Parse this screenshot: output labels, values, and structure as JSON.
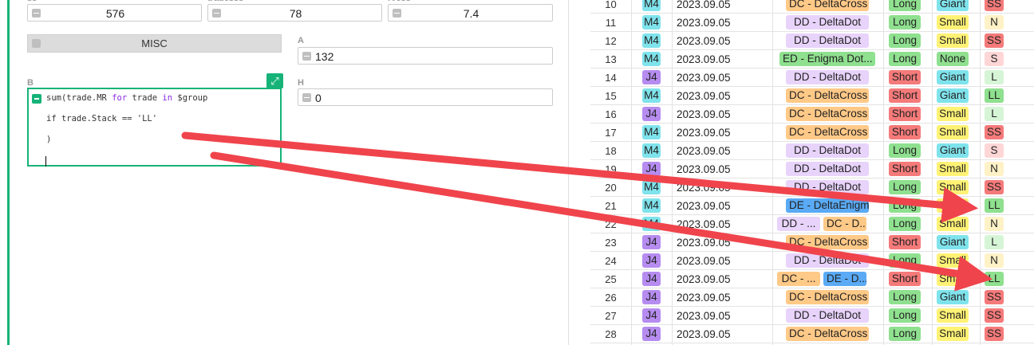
{
  "fields": {
    "top": [
      {
        "label": "ss",
        "value": "576"
      },
      {
        "label": "tradesss",
        "value": "78"
      },
      {
        "label": "rvess",
        "value": "7.4"
      }
    ],
    "misc_label": "MISC",
    "a": {
      "label": "A",
      "value": "132"
    },
    "b": {
      "label": "B"
    },
    "h": {
      "label": "H",
      "value": "0"
    }
  },
  "formula": {
    "line1": {
      "pre": "sum(trade.MR ",
      "kw1": "for",
      "mid": " trade ",
      "kw2": "in",
      "post": " $group"
    },
    "line2": "if trade.Stack == 'LL'",
    "line3": ")"
  },
  "colors": {
    "accent": "#16b378",
    "chip": {
      "M4": "#7fe3ec",
      "J4": "#b68cf0",
      "DC": "#ffc987",
      "DD": "#e8d3fb",
      "ED": "#8fe08f",
      "DE": "#5aaaf5",
      "Long": "#8fe08f",
      "Short": "#f57a7a",
      "Giant": "#7fe3ec",
      "Small": "#fff275",
      "None": "#8fe08f",
      "SS": "#f57a7a",
      "S": "#ffd6d6",
      "L": "#d6f5d6",
      "LL": "#8fe08f",
      "N": "#fff2c7"
    }
  },
  "grid": {
    "rows": [
      {
        "num": "10",
        "acct": "M4",
        "date": "2023.09.05",
        "strategies": [
          "DC - DeltaCross"
        ],
        "dir": "Long",
        "size": "Giant",
        "stack": "SS"
      },
      {
        "num": "11",
        "acct": "M4",
        "date": "2023.09.05",
        "strategies": [
          "DD - DeltaDot"
        ],
        "dir": "Long",
        "size": "Small",
        "stack": "N"
      },
      {
        "num": "12",
        "acct": "M4",
        "date": "2023.09.05",
        "strategies": [
          "DD - DeltaDot"
        ],
        "dir": "Long",
        "size": "Small",
        "stack": "SS"
      },
      {
        "num": "13",
        "acct": "M4",
        "date": "2023.09.05",
        "strategies": [
          "ED - Enigma Dot..."
        ],
        "dir": "Long",
        "size": "None",
        "stack": "S"
      },
      {
        "num": "14",
        "acct": "J4",
        "date": "2023.09.05",
        "strategies": [
          "DD - DeltaDot"
        ],
        "dir": "Short",
        "size": "Giant",
        "stack": "L"
      },
      {
        "num": "15",
        "acct": "M4",
        "date": "2023.09.05",
        "strategies": [
          "DC - DeltaCross"
        ],
        "dir": "Short",
        "size": "Giant",
        "stack": "LL"
      },
      {
        "num": "16",
        "acct": "J4",
        "date": "2023.09.05",
        "strategies": [
          "DC - DeltaCross"
        ],
        "dir": "Short",
        "size": "Small",
        "stack": "L"
      },
      {
        "num": "17",
        "acct": "M4",
        "date": "2023.09.05",
        "strategies": [
          "DC - DeltaCross"
        ],
        "dir": "Short",
        "size": "Small",
        "stack": "SS"
      },
      {
        "num": "18",
        "acct": "M4",
        "date": "2023.09.05",
        "strategies": [
          "DD - DeltaDot"
        ],
        "dir": "Long",
        "size": "Giant",
        "stack": "S"
      },
      {
        "num": "19",
        "acct": "J4",
        "date": "2023.09.05",
        "strategies": [
          "DD - DeltaDot"
        ],
        "dir": "Short",
        "size": "Small",
        "stack": "N"
      },
      {
        "num": "20",
        "acct": "M4",
        "date": "2023.09.05",
        "strategies": [
          "DD - DeltaDot"
        ],
        "dir": "Long",
        "size": "Small",
        "stack": "SS"
      },
      {
        "num": "21",
        "acct": "M4",
        "date": "2023.09.05",
        "strategies": [
          "DE - DeltaEnigma"
        ],
        "dir": "Long",
        "size": "Small",
        "stack": "LL"
      },
      {
        "num": "22",
        "acct": "M4",
        "date": "2023.09.05",
        "strategies": [
          "DD - ...",
          "DC - D..."
        ],
        "dir": "Long",
        "size": "Small",
        "stack": "N"
      },
      {
        "num": "23",
        "acct": "J4",
        "date": "2023.09.05",
        "strategies": [
          "DC - DeltaCross"
        ],
        "dir": "Short",
        "size": "Giant",
        "stack": "L"
      },
      {
        "num": "24",
        "acct": "J4",
        "date": "2023.09.05",
        "strategies": [
          "DD - DeltaDot"
        ],
        "dir": "Long",
        "size": "Small",
        "stack": "N"
      },
      {
        "num": "25",
        "acct": "J4",
        "date": "2023.09.05",
        "strategies": [
          "DC - ...",
          "DE - D..."
        ],
        "dir": "Short",
        "size": "Small",
        "stack": "LL"
      },
      {
        "num": "26",
        "acct": "J4",
        "date": "2023.09.05",
        "strategies": [
          "DC - DeltaCross"
        ],
        "dir": "Long",
        "size": "Giant",
        "stack": "SS"
      },
      {
        "num": "27",
        "acct": "J4",
        "date": "2023.09.05",
        "strategies": [
          "DD - DeltaDot"
        ],
        "dir": "Long",
        "size": "Small",
        "stack": "SS"
      },
      {
        "num": "28",
        "acct": "J4",
        "date": "2023.09.05",
        "strategies": [
          "DC - DeltaCross"
        ],
        "dir": "Long",
        "size": "Small",
        "stack": "SS"
      }
    ]
  }
}
